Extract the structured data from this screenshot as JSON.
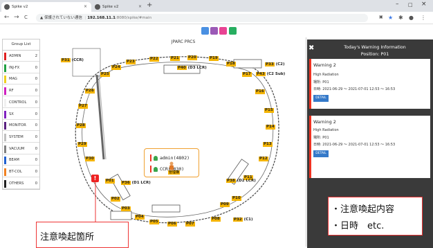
{
  "browser": {
    "tabs": [
      {
        "label": "Spike v2",
        "close": "×"
      },
      {
        "label": "Spike v2",
        "close": "×"
      }
    ],
    "new_tab": "+",
    "window_controls": {
      "minimize": "–",
      "maximize": "□",
      "close": "×"
    },
    "nav": {
      "back": "←",
      "forward": "→",
      "reload": "C"
    },
    "address": {
      "security": "▲ 保護されていない通信",
      "host": "192.168.11.1",
      "path": ":8080/spike/#main"
    }
  },
  "group_list": {
    "title": "Group List",
    "items": [
      {
        "name": "ADMIN",
        "count": "2",
        "color": "#e02020"
      },
      {
        "name": "INJ-FX",
        "count": "0",
        "color": "#20a040"
      },
      {
        "name": "MAG",
        "count": "0",
        "color": "#f0d020"
      },
      {
        "name": "RF",
        "count": "0",
        "color": "#d020c0"
      },
      {
        "name": "CONTROL",
        "count": "0",
        "color": "#f0f0f0"
      },
      {
        "name": "SX",
        "count": "0",
        "color": "#8020c0"
      },
      {
        "name": "MONITOR",
        "count": "0",
        "color": "#5a2080"
      },
      {
        "name": "SYSTEM",
        "count": "0",
        "color": "#c0c0c0"
      },
      {
        "name": "VACUUM",
        "count": "0",
        "color": "#808080"
      },
      {
        "name": "BEAM",
        "count": "0",
        "color": "#2060d0"
      },
      {
        "name": "BT-COL",
        "count": "0",
        "color": "#f08020"
      },
      {
        "name": "OTHERS",
        "count": "0",
        "color": "#202020"
      }
    ]
  },
  "map": {
    "title": "JPARC PRCS",
    "point_labels": [
      "P01",
      "P02",
      "P03",
      "P04",
      "P05",
      "P06",
      "P07",
      "P08",
      "P09",
      "P10",
      "P11",
      "P12",
      "P13",
      "P14",
      "P15",
      "P16",
      "P17",
      "P18",
      "P19",
      "P20",
      "P21",
      "P22",
      "P23",
      "P24",
      "P25",
      "P26",
      "P27",
      "P28",
      "P29",
      "P30"
    ],
    "tagged_labels": [
      {
        "code": "P31",
        "text": "(CCR)"
      },
      {
        "code": "P33",
        "text": "(C2)"
      },
      {
        "code": "P43",
        "text": "(C2 Sub)"
      },
      {
        "code": "P40",
        "text": "(D3 LCR)"
      },
      {
        "code": "P36",
        "text": "(D1 LCR)"
      },
      {
        "code": "P38",
        "text": "(D2 LCR)"
      },
      {
        "code": "P32",
        "text": "(C1)"
      }
    ],
    "users": [
      {
        "name": "admin(4802)"
      },
      {
        "name": "CCR(4030)"
      }
    ],
    "person_label": "管理棟",
    "warning_mark": "!"
  },
  "warning_panel": {
    "close": "✖",
    "title": "Today's Warning Information",
    "position": "Position: P01",
    "cards": [
      {
        "title": "Warning 2",
        "type": "High Radiation",
        "place": "場所: P01",
        "dates": "日時: 2021-06-29 ～ 2021-07-01    12:53 ～ 16:53",
        "button": "DETAIL"
      },
      {
        "title": "Warning 2",
        "type": "High Radiation",
        "place": "場所: P01",
        "dates": "日時: 2021-06-29 ～ 2021-07-01    12:53 ～ 16:53",
        "button": "DETAIL"
      }
    ]
  },
  "annotations": {
    "left": "注意喚起箇所",
    "right_line1": "・注意喚起内容",
    "right_line2": "・日時　etc."
  },
  "colors": {
    "accent": "#f4b400",
    "warning": "#e22222",
    "panel": "#3a3a3a",
    "detail_button": "#3479c9"
  }
}
